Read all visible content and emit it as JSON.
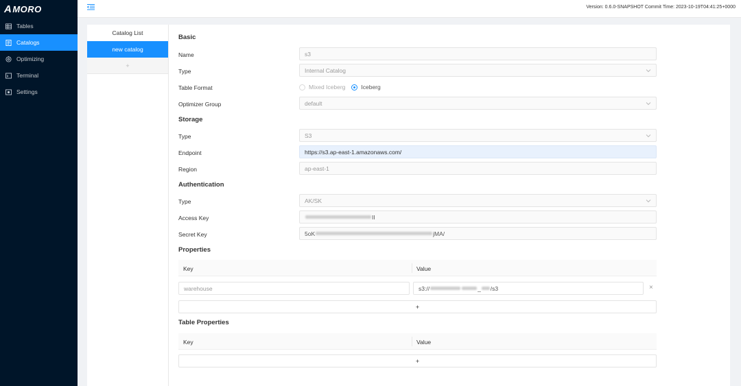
{
  "app": {
    "logo_text": "MORO",
    "logo_mark": "A"
  },
  "sidebar": {
    "items": [
      {
        "label": "Tables",
        "icon": "table-icon"
      },
      {
        "label": "Catalogs",
        "icon": "catalog-icon",
        "active": true
      },
      {
        "label": "Optimizing",
        "icon": "optimizing-icon"
      },
      {
        "label": "Terminal",
        "icon": "terminal-icon"
      },
      {
        "label": "Settings",
        "icon": "settings-icon"
      }
    ]
  },
  "header": {
    "version_text": "Version: 0.6.0-SNAPSHOT   Commit Time: 2023-10-19T04:41:25+0000"
  },
  "catalog_list": {
    "title": "Catalog List",
    "items": [
      "new catalog"
    ],
    "add_label": "+"
  },
  "form": {
    "basic": {
      "title": "Basic",
      "name_label": "Name",
      "name_value": "s3",
      "type_label": "Type",
      "type_value": "Internal Catalog",
      "table_format_label": "Table Format",
      "table_format_options": [
        "Mixed Iceberg",
        "Iceberg"
      ],
      "table_format_selected": "Iceberg",
      "optimizer_group_label": "Optimizer Group",
      "optimizer_group_value": "default"
    },
    "storage": {
      "title": "Storage",
      "type_label": "Type",
      "type_value": "S3",
      "endpoint_label": "Endpoint",
      "endpoint_value": "https://s3.ap-east-1.amazonaws.com/",
      "region_label": "Region",
      "region_value": "ap-east-1"
    },
    "authentication": {
      "title": "Authentication",
      "type_label": "Type",
      "type_value": "AK/SK",
      "access_key_label": "Access Key",
      "access_key_suffix": "II",
      "secret_key_label": "Secret Key",
      "secret_key_prefix": "5oK",
      "secret_key_suffix": "jMA/"
    },
    "properties": {
      "title": "Properties",
      "key_header": "Key",
      "value_header": "Value",
      "rows": [
        {
          "key": "warehouse",
          "value_prefix": "s3://",
          "value_mid": "_",
          "value_suffix": "/s3"
        }
      ],
      "remove_label": "×",
      "add_label": "+"
    },
    "table_properties": {
      "title": "Table Properties",
      "key_header": "Key",
      "value_header": "Value",
      "add_label": "+"
    }
  },
  "colors": {
    "sidebar_bg": "#001529",
    "accent": "#1890ff",
    "endpoint_bg": "#e8f1fd"
  }
}
